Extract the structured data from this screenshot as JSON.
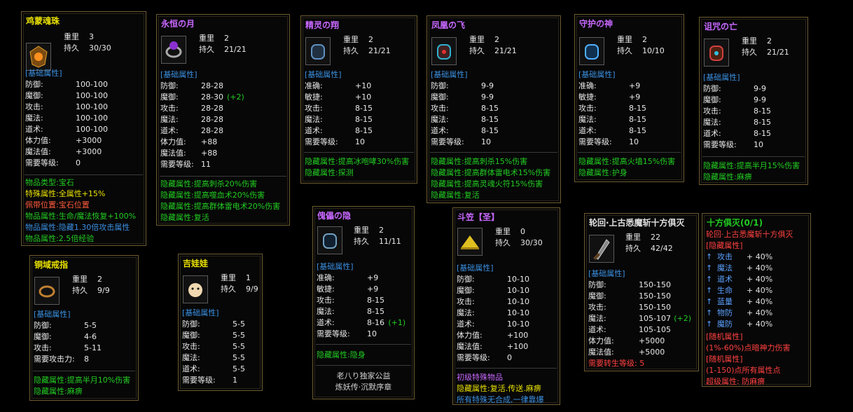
{
  "panels": {
    "p1": {
      "title": "鸡蒙魂珠",
      "wt_label": "重里",
      "wt": "3",
      "dur_label": "持久",
      "dur": "30/30",
      "base": "[基础属性]",
      "stats": [
        [
          "防御:",
          "100-100"
        ],
        [
          "魔御:",
          "100-100"
        ],
        [
          "攻击:",
          "100-100"
        ],
        [
          "魔法:",
          "100-100"
        ],
        [
          "道术:",
          "100-100"
        ],
        [
          "体力值:",
          "+3000"
        ],
        [
          "魔法值:",
          "+3000"
        ],
        [
          "需要等级:",
          "0"
        ]
      ],
      "extra": [
        {
          "t": "物品类型:",
          "v": "宝石",
          "c": "#22cc22",
          "vc": "#22cc22"
        },
        {
          "t": "特殊属性:",
          "v": "全属性+15%",
          "c": "#e8e000",
          "vc": "#e8e000"
        },
        {
          "t": "佩带位置:",
          "v": "宝石位置",
          "c": "#ff5a3c",
          "vc": "#ff5a3c"
        },
        {
          "t": "物品属性:",
          "v": "生命/魔法恢复+100%",
          "c": "#22cc22",
          "vc": "#22cc22"
        },
        {
          "t": "物品属性:",
          "v": "隐藏1.30倍攻击属性",
          "c": "#3a8fe0",
          "vc": "#3a8fe0"
        },
        {
          "t": "物品属性:",
          "v": "2.5倍经验",
          "c": "#22cc22",
          "vc": "#22cc22"
        }
      ]
    },
    "p2": {
      "title": "永恒の月",
      "wt_label": "重里",
      "wt": "2",
      "dur_label": "持久",
      "dur": "21/21",
      "base": "[基础属性]",
      "stats": [
        [
          "防御:",
          "28-28",
          ""
        ],
        [
          "魔御:",
          "28-30",
          "(+2)"
        ],
        [
          "攻击:",
          "28-28",
          ""
        ],
        [
          "魔法:",
          "28-28",
          ""
        ],
        [
          "道术:",
          "28-28",
          ""
        ],
        [
          "体力值:",
          "+88",
          ""
        ],
        [
          "魔法值:",
          "+88",
          ""
        ],
        [
          "需要等级:",
          "11",
          ""
        ]
      ],
      "hidden": [
        "隐藏属性:提高刺杀20%伤害",
        "隐藏属性:提高噬血术20%伤害",
        "隐藏属性:提高群体雷电术20%伤害",
        "隐藏属性:复活"
      ]
    },
    "p3": {
      "title": "精灵の翔",
      "wt_label": "重里",
      "wt": "2",
      "dur_label": "持久",
      "dur": "21/21",
      "base": "[基础属性]",
      "stats": [
        [
          "准确:",
          "+10"
        ],
        [
          "敏捷:",
          "+10"
        ],
        [
          "攻击:",
          "8-15"
        ],
        [
          "魔法:",
          "8-15"
        ],
        [
          "道术:",
          "8-15"
        ],
        [
          "需要等级:",
          "10"
        ]
      ],
      "hidden": [
        "隐藏属性:提高冰咆哮30%伤害",
        "隐藏属性:探测"
      ]
    },
    "p4": {
      "title": "凤凰の飞",
      "wt_label": "重里",
      "wt": "2",
      "dur_label": "持久",
      "dur": "21/21",
      "base": "[基础属性]",
      "stats": [
        [
          "防御:",
          "9-9"
        ],
        [
          "魔御:",
          "9-9"
        ],
        [
          "攻击:",
          "8-15"
        ],
        [
          "魔法:",
          "8-15"
        ],
        [
          "道术:",
          "8-15"
        ],
        [
          "需要等级:",
          "10"
        ]
      ],
      "hidden": [
        "隐藏属性:提高刺杀15%伤害",
        "隐藏属性:提高群体雷电术15%伤害",
        "隐藏属性:提高灵魂火符15%伤害",
        "隐藏属性:复活"
      ]
    },
    "p5": {
      "title": "守护の神",
      "wt_label": "重里",
      "wt": "2",
      "dur_label": "持久",
      "dur": "10/10",
      "base": "[基础属性]",
      "stats": [
        [
          "准确:",
          "+9"
        ],
        [
          "敏捷:",
          "+9"
        ],
        [
          "攻击:",
          "8-15"
        ],
        [
          "魔法:",
          "8-15"
        ],
        [
          "道术:",
          "8-15"
        ],
        [
          "需要等级:",
          "10"
        ]
      ],
      "hidden": [
        "隐藏属性:提高火墙15%伤害",
        "隐藏属性:护身"
      ]
    },
    "p6": {
      "title": "诅咒の亡",
      "wt_label": "重里",
      "wt": "2",
      "dur_label": "持久",
      "dur": "21/21",
      "base": "[基础属性]",
      "stats": [
        [
          "防御:",
          "9-9"
        ],
        [
          "魔御:",
          "9-9"
        ],
        [
          "攻击:",
          "8-15"
        ],
        [
          "魔法:",
          "8-15"
        ],
        [
          "道术:",
          "8-15"
        ],
        [
          "需要等级:",
          "10"
        ]
      ],
      "hidden": [
        "隐藏属性:提高半月15%伤害",
        "隐藏属性:麻痹"
      ]
    },
    "p7": {
      "title": "铜域戒指",
      "wt_label": "重里",
      "wt": "2",
      "dur_label": "持久",
      "dur": "9/9",
      "base": "[基础属性]",
      "stats": [
        [
          "防御:",
          "5-5"
        ],
        [
          "魔御:",
          "4-6"
        ],
        [
          "攻击:",
          "5-11"
        ],
        [
          "需要攻击力:",
          "8"
        ]
      ],
      "hidden": [
        "隐藏属性:提高半月10%伤害",
        "隐藏属性:麻痹"
      ]
    },
    "p8": {
      "title": "吉娃娃",
      "wt_label": "重里",
      "wt": "1",
      "dur_label": "持久",
      "dur": "9/9",
      "base": "[基础属性]",
      "stats": [
        [
          "防御:",
          "5-5"
        ],
        [
          "魔御:",
          "5-5"
        ],
        [
          "攻击:",
          "5-5"
        ],
        [
          "魔法:",
          "5-5"
        ],
        [
          "道术:",
          "5-5"
        ],
        [
          "需要等级:",
          "1"
        ]
      ]
    },
    "p9": {
      "title": "傀儡の隐",
      "wt_label": "重里",
      "wt": "2",
      "dur_label": "持久",
      "dur": "11/11",
      "base": "[基础属性]",
      "stats": [
        [
          "准确:",
          "+9",
          ""
        ],
        [
          "敏捷:",
          "+9",
          ""
        ],
        [
          "攻击:",
          "8-15",
          ""
        ],
        [
          "魔法:",
          "8-15",
          ""
        ],
        [
          "道术:",
          "8-16",
          "(+1)"
        ],
        [
          "需要等级:",
          "10",
          ""
        ]
      ],
      "hidden": [
        "隐藏属性:隐身"
      ],
      "footer": [
        "老八り独家公益",
        "炼妖传·沉默序章"
      ]
    },
    "p10": {
      "title": "斗笠【圣】",
      "wt_label": "重里",
      "wt": "0",
      "dur_label": "持久",
      "dur": "30/30",
      "base": "[基础属性]",
      "stats": [
        [
          "防御:",
          "10-10"
        ],
        [
          "魔御:",
          "10-10"
        ],
        [
          "攻击:",
          "10-10"
        ],
        [
          "魔法:",
          "10-10"
        ],
        [
          "道术:",
          "10-10"
        ],
        [
          "体力值:",
          "+100"
        ],
        [
          "魔法值:",
          "+100"
        ],
        [
          "需要等级:",
          "0"
        ]
      ],
      "special": "初级特殊物品",
      "hidden_line": "隐藏属性:复活.传送.麻痹",
      "note": "所有特殊无合成,一律靠爆"
    },
    "p11": {
      "title": "轮回·上古悉魔斩十方俱灭",
      "wt_label": "重里",
      "wt": "22",
      "dur_label": "持久",
      "dur": "42/42",
      "base": "[基础属性]",
      "stats": [
        [
          "防御:",
          "150-150",
          ""
        ],
        [
          "魔御:",
          "150-150",
          ""
        ],
        [
          "攻击:",
          "150-150",
          ""
        ],
        [
          "魔法:",
          "105-107",
          "(+2)"
        ],
        [
          "道术:",
          "105-105",
          ""
        ],
        [
          "体力值:",
          "+5000",
          ""
        ],
        [
          "魔法值:",
          "+5000",
          ""
        ]
      ],
      "req": "需要转生等级: 5"
    },
    "p12": {
      "title": "十方俱灭(0/1)",
      "name": "轮回·上古悉魔斩十方俱灭",
      "hidden_label": "[隐藏属性]",
      "boosts": [
        [
          "攻击",
          "+ 40%"
        ],
        [
          "魔法",
          "+ 40%"
        ],
        [
          "道术",
          "+ 40%"
        ],
        [
          "生命",
          "+ 40%"
        ],
        [
          "蓝量",
          "+ 40%"
        ],
        [
          "物防",
          "+ 40%"
        ],
        [
          "魔防",
          "+ 40%"
        ]
      ],
      "rand1_label": "[随机属性]",
      "rand1": "(1%-60%)点暗神力伤害",
      "rand2_label": "[随机属性]",
      "rand2": "(1-150)点所有属性点",
      "super": "超级属性: 防麻痹"
    }
  },
  "colors": {
    "base": "#3a8fe0",
    "hidden": "#22cc22",
    "title_gold": "#e8e000",
    "title_purple": "#c868ff",
    "plus": "#22cc22",
    "red": "#ff4040"
  }
}
